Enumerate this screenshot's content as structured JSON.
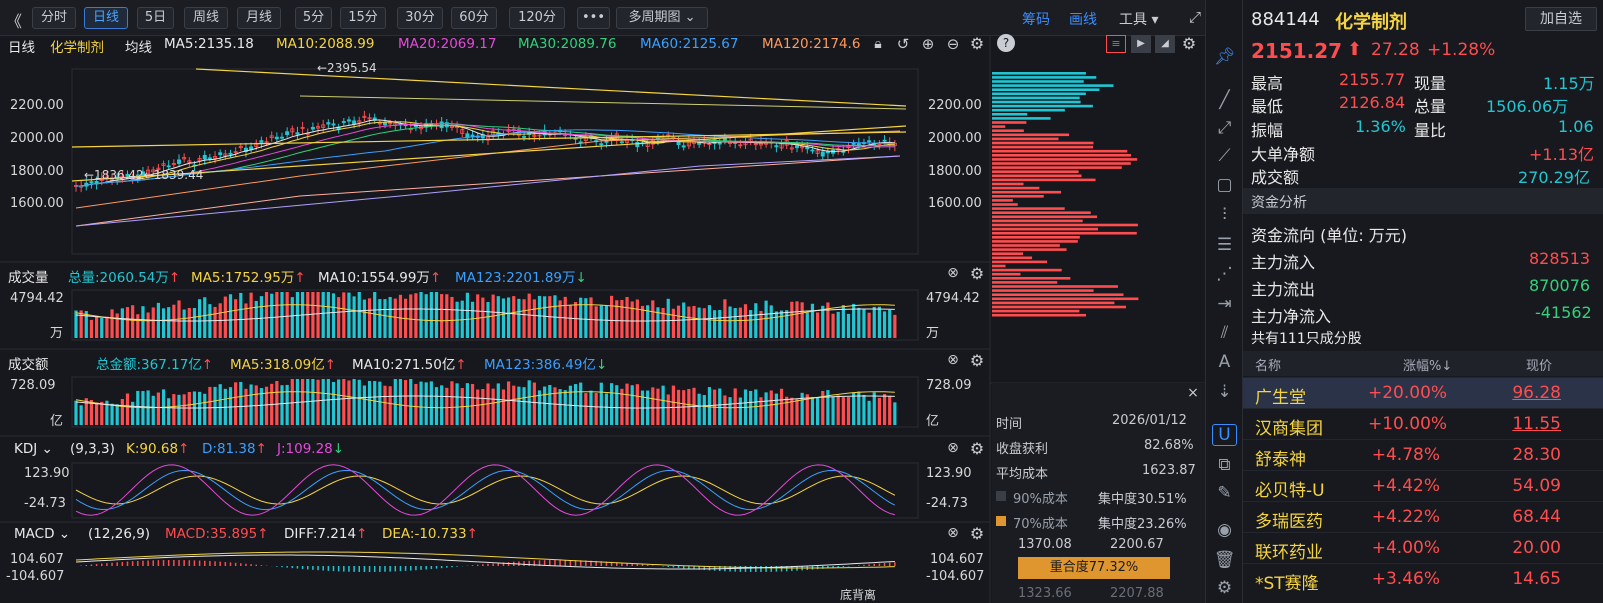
{
  "toolbar": {
    "periods": [
      {
        "label": "分时",
        "active": false
      },
      {
        "label": "日线",
        "active": true
      },
      {
        "label": "5日",
        "active": false
      },
      {
        "label": "周线",
        "active": false
      },
      {
        "label": "月线",
        "active": false
      },
      {
        "label": "5分",
        "active": false
      },
      {
        "label": "15分",
        "active": false
      },
      {
        "label": "30分",
        "active": false
      },
      {
        "label": "60分",
        "active": false
      },
      {
        "label": "120分",
        "active": false
      }
    ],
    "more_label": "•••",
    "multi_period_label": "多周期图",
    "chips_label": "筹码",
    "draw_label": "画线",
    "tools_label": "工具"
  },
  "main_chart": {
    "period_label": "日线",
    "name": "化学制剂",
    "ma_label": "均线",
    "ma5": "MA5:2135.18",
    "ma10": "MA10:2088.99",
    "ma20": "MA20:2069.17",
    "ma30": "MA30:2089.76",
    "ma60": "MA60:2125.67",
    "ma120": "MA120:2174.6",
    "high_mark": "←2395.54",
    "low_mark": "←1836.42←1839.44",
    "y_labels": [
      "2200.00",
      "2000.00",
      "1800.00",
      "1600.00"
    ]
  },
  "volume": {
    "title": "成交量",
    "total": "总量:2060.54万",
    "ma5": "MA5:1752.95万",
    "ma10": "MA10:1554.99万",
    "ma123": "MA123:2201.89万",
    "top": "4794.42",
    "unit": "万"
  },
  "amount": {
    "title": "成交额",
    "total": "总金额:367.17亿",
    "ma5": "MA5:318.09亿",
    "ma10": "MA10:271.50亿",
    "ma123": "MA123:386.49亿",
    "top": "728.09",
    "unit": "亿"
  },
  "kdj": {
    "title": "KDJ",
    "params": "(9,3,3)",
    "k": "K:90.68",
    "d": "D:81.38",
    "j": "J:109.28",
    "top": "123.90",
    "bottom": "-24.73"
  },
  "macd": {
    "title": "MACD",
    "params": "(12,26,9)",
    "macd": "MACD:35.895",
    "diff": "DIFF:7.214",
    "dea": "DEA:-10.733",
    "top": "104.607",
    "bottom": "-104.607",
    "annotation": "底背离"
  },
  "chip_panel": {
    "time_label": "时间",
    "time_value": "2026/01/12",
    "profit_label": "收盘获利",
    "profit_value": "82.68%",
    "avg_cost_label": "平均成本",
    "avg_cost_value": "1623.87",
    "cost90_label": "90%成本",
    "conc90": "集中度30.51%",
    "cost70_label": "70%成本",
    "conc70": "集中度23.26%",
    "range_low": "1370.08",
    "range_high": "2200.67",
    "overlap": "重合度77.32%",
    "bottom_left": "1323.66",
    "bottom_right": "2207.88"
  },
  "quote": {
    "code": "884144",
    "name": "化学制剂",
    "add_fav": "加自选",
    "price": "2151.27",
    "change": "27.28",
    "change_pct": "+1.28%",
    "high_label": "最高",
    "high": "2155.77",
    "volnow_label": "现量",
    "volnow": "1.15万",
    "low_label": "最低",
    "low": "2126.84",
    "totalvol_label": "总量",
    "totalvol": "1506.06万",
    "amp_label": "振幅",
    "amp": "1.36%",
    "ratio_label": "量比",
    "ratio": "1.06",
    "big_label": "大单净额",
    "big": "+1.13亿",
    "turnover_label": "成交额",
    "turnover": "270.29亿"
  },
  "fund": {
    "section_title": "资金分析",
    "flow_title": "资金流向 (单位: 万元)",
    "in_label": "主力流入",
    "in": "828513",
    "out_label": "主力流出",
    "out": "870076",
    "net_label": "主力净流入",
    "net": "-41562",
    "constituents": "共有111只成分股"
  },
  "stock_table": {
    "headers": [
      "名称",
      "涨幅%↓",
      "现价"
    ],
    "rows": [
      {
        "name": "广生堂",
        "pct": "+20.00%",
        "price": "96.28"
      },
      {
        "name": "汉商集团",
        "pct": "+10.00%",
        "price": "11.55"
      },
      {
        "name": "舒泰神",
        "pct": "+4.78%",
        "price": "28.30"
      },
      {
        "name": "必贝特-U",
        "pct": "+4.42%",
        "price": "54.09"
      },
      {
        "name": "多瑞医药",
        "pct": "+4.22%",
        "price": "68.44"
      },
      {
        "name": "联环药业",
        "pct": "+4.00%",
        "price": "20.00"
      },
      {
        "name": "*ST赛隆",
        "pct": "+3.46%",
        "price": "14.65"
      }
    ]
  },
  "colors": {
    "up": "#ff4d4f",
    "down": "#33d17a",
    "accent": "#3a8dff",
    "bg": "#16181d"
  }
}
